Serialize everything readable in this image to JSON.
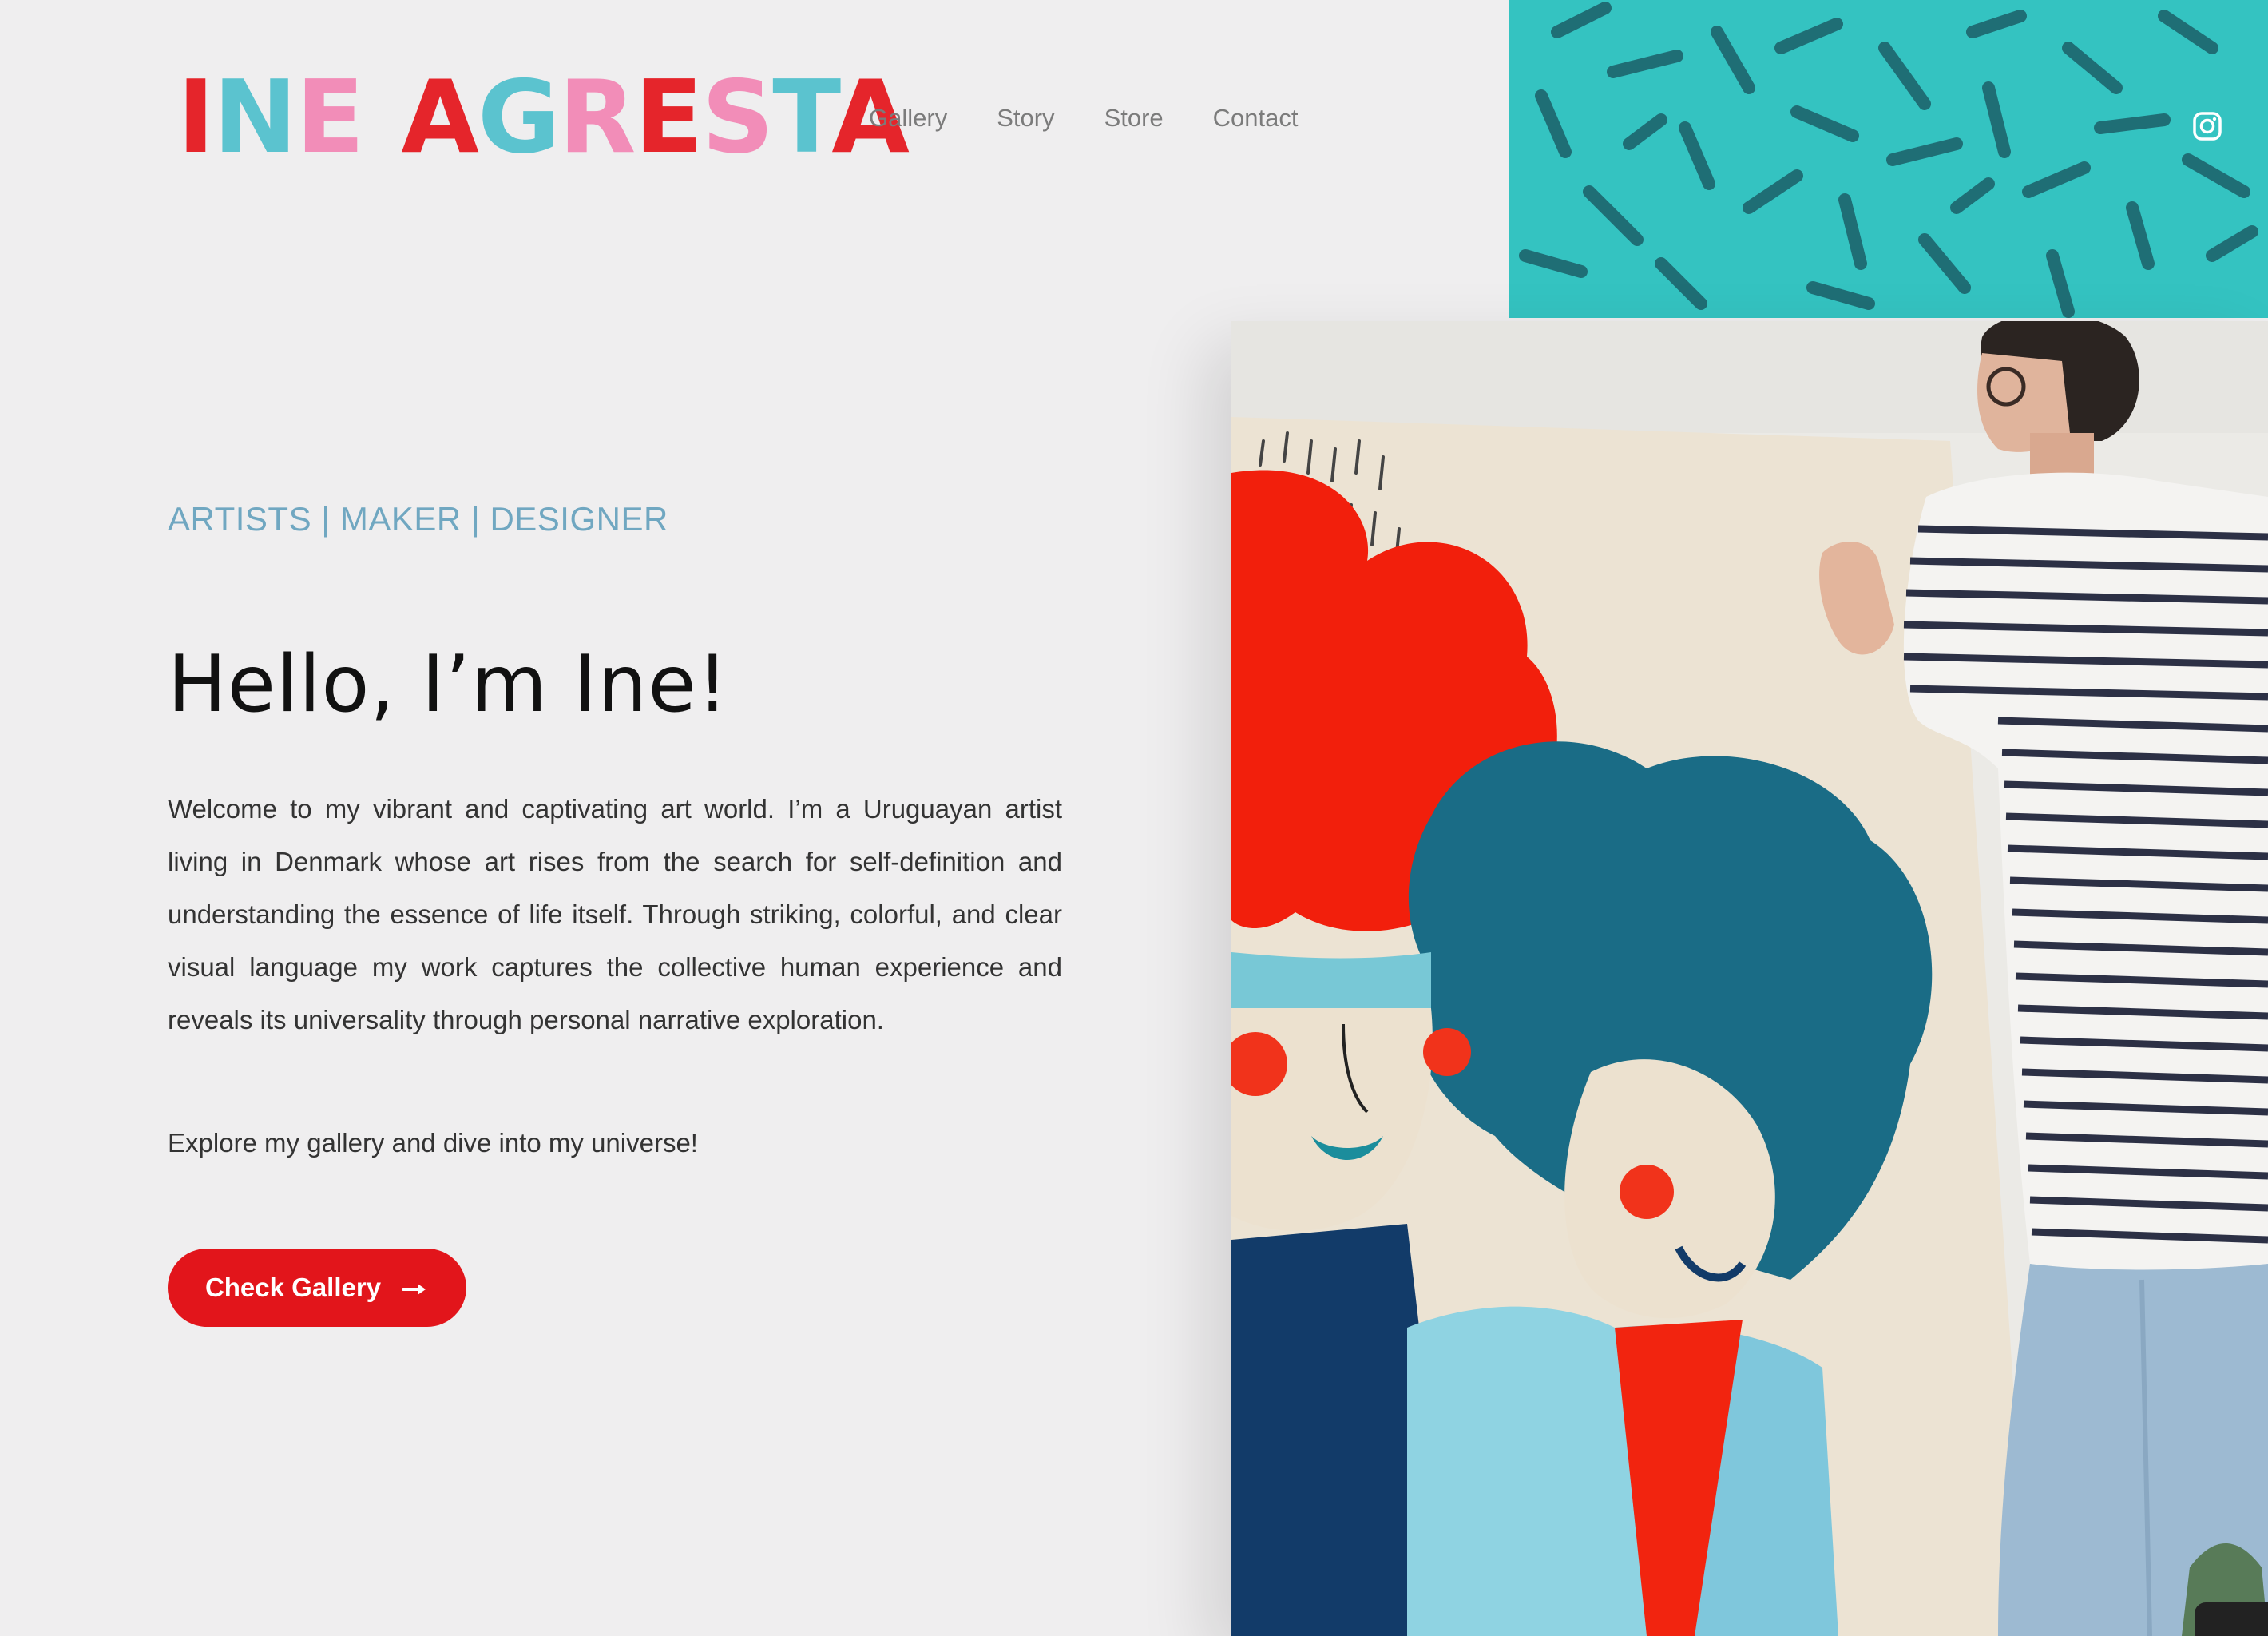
{
  "brand": {
    "logo_part1": "INE",
    "logo_part2": "AGRESTA",
    "logo_letter_colors": {
      "part1": [
        "#e5252b",
        "#5bc3cf",
        "#f28db8"
      ],
      "part2": [
        "#e5252b",
        "#5bc3cf",
        "#f28db8",
        "#e5252b",
        "#f28db8",
        "#5bc3cf",
        "#e5252b"
      ]
    }
  },
  "nav": {
    "items": [
      {
        "label": "Gallery"
      },
      {
        "label": "Story"
      },
      {
        "label": "Store"
      },
      {
        "label": "Contact"
      }
    ]
  },
  "social": {
    "instagram_icon": "instagram-icon"
  },
  "hero": {
    "tagline": "ARTISTS | MAKER | DESIGNER",
    "headline": "Hello, I’m Ine!",
    "intro": "Welcome to my vibrant and captivating art world. I’m a Uruguayan artist living in Denmark whose art rises from the search for self-definition and understanding the essence of life itself. Through striking, colorful, and clear visual language my work captures the collective human experience and reveals its universality through personal narrative exploration.",
    "invite": "Explore my gallery and dive into my universe!",
    "cta_label": "Check Gallery",
    "cta_icon": "arrow-right-icon",
    "photo_icon": "artist-painting-photo"
  },
  "colors": {
    "background": "#efeeef",
    "accent_red": "#e2151b",
    "tagline_blue": "#70a7c1",
    "teal": "#35c6c4",
    "text_dark": "#111111",
    "nav_gray": "#7b7b7b"
  }
}
